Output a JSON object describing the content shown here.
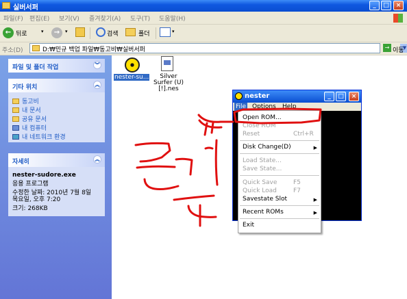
{
  "window": {
    "title": "실버서퍼"
  },
  "menubar": [
    "파일(F)",
    "편집(E)",
    "보기(V)",
    "즐겨찾기(A)",
    "도구(T)",
    "도움말(H)"
  ],
  "toolbar": {
    "back": "뒤로",
    "search": "검색",
    "folders": "폴더"
  },
  "address": {
    "label": "주소(D)",
    "path": "D:₩민규 백업 파일₩동고비₩실버서퍼",
    "go": "이동"
  },
  "taskpane": {
    "file_tasks": "파일 및 폴더 작업",
    "other_places": {
      "title": "기타 위치",
      "items": [
        "동고비",
        "내 문서",
        "공유 문서",
        "내 컴퓨터",
        "내 네트워크 환경"
      ]
    },
    "details": {
      "title": "자세히",
      "name": "nester-sudore.exe",
      "type": "응용 프로그램",
      "modified_1": "수정한 날짜: 2010년 7월 8일",
      "modified_2": "목요일, 오후 7:20",
      "size": "크기: 268KB"
    }
  },
  "files": [
    {
      "label": "nester-su...",
      "icon": "nester-app-icon"
    },
    {
      "label": "Silver Surfer (U) [!].nes",
      "icon": "nes-rom-icon"
    }
  ],
  "nester": {
    "title": "nester",
    "menu": [
      "File",
      "Options",
      "Help"
    ],
    "file_menu": {
      "open_rom": "Open ROM...",
      "close_rom": "Close ROM",
      "reset": "Reset",
      "reset_shortcut": "Ctrl+R",
      "disk_change": "Disk Change(D)",
      "load_state": "Load State...",
      "save_state": "Save State...",
      "quick_save": "Quick Save",
      "quick_save_key": "F5",
      "quick_load": "Quick Load",
      "quick_load_key": "F7",
      "savestate_slot": "Savestate Slot",
      "recent_roms": "Recent ROMs",
      "exit": "Exit"
    }
  },
  "colors": {
    "annotation": "#e01010",
    "xp_blue": "#0a4ed1",
    "taskpane": "#6f8ce0"
  }
}
